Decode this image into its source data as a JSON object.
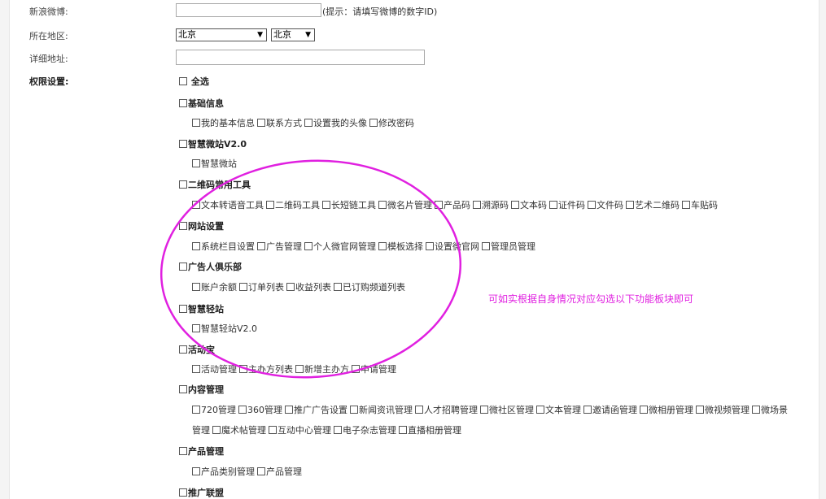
{
  "form": {
    "weibo_label": "新浪微博:",
    "weibo_value": "",
    "weibo_hint": "(提示：请填写微博的数字ID)",
    "region_label": "所在地区:",
    "province_value": "北京",
    "city_value": "北京",
    "address_label": "详细地址:",
    "address_value": "",
    "permission_label": "权限设置:"
  },
  "permissions": {
    "select_all": "全选",
    "groups": [
      {
        "title": "基础信息",
        "items": [
          "我的基本信息",
          "联系方式",
          "设置我的头像",
          "修改密码"
        ]
      },
      {
        "title": "智慧微站V2.0",
        "items": [
          "智慧微站"
        ]
      },
      {
        "title": "二维码常用工具",
        "items": [
          "文本转语音工具",
          "二维码工具",
          "长短链工具",
          "微名片管理",
          "产品码",
          "溯源码",
          "文本码",
          "证件码",
          "文件码",
          "艺术二维码",
          "车贴码"
        ]
      },
      {
        "title": "网站设置",
        "items": [
          "系统栏目设置",
          "广告管理",
          "个人微官网管理",
          "模板选择",
          "设置微官网",
          "管理员管理"
        ]
      },
      {
        "title": "广告人俱乐部",
        "items": [
          "账户余额",
          "订单列表",
          "收益列表",
          "已订购频道列表"
        ]
      },
      {
        "title": "智慧轻站",
        "items": [
          "智慧轻站V2.0"
        ]
      },
      {
        "title": "活动宝",
        "items": [
          "活动管理",
          "主办方列表",
          "新增主办方",
          "申请管理"
        ]
      },
      {
        "title": "内容管理",
        "items": [
          "720管理",
          "360管理",
          "推广广告设置",
          "新闻资讯管理",
          "人才招聘管理",
          "微社区管理",
          "文本管理",
          "邀请函管理",
          "微相册管理",
          "微视频管理",
          "微场景"
        ]
      },
      {
        "title": "",
        "items": [
          "管理",
          "魔术帖管理",
          "互动中心管理",
          "电子杂志管理",
          "直播相册管理"
        ]
      },
      {
        "title": "产品管理",
        "items": [
          "产品类别管理",
          "产品管理"
        ]
      },
      {
        "title": "推广联盟",
        "items": []
      }
    ]
  },
  "annotation": {
    "text": "可如实根据自身情况对应勾选以下功能板块即可",
    "color": "#e020e0"
  }
}
